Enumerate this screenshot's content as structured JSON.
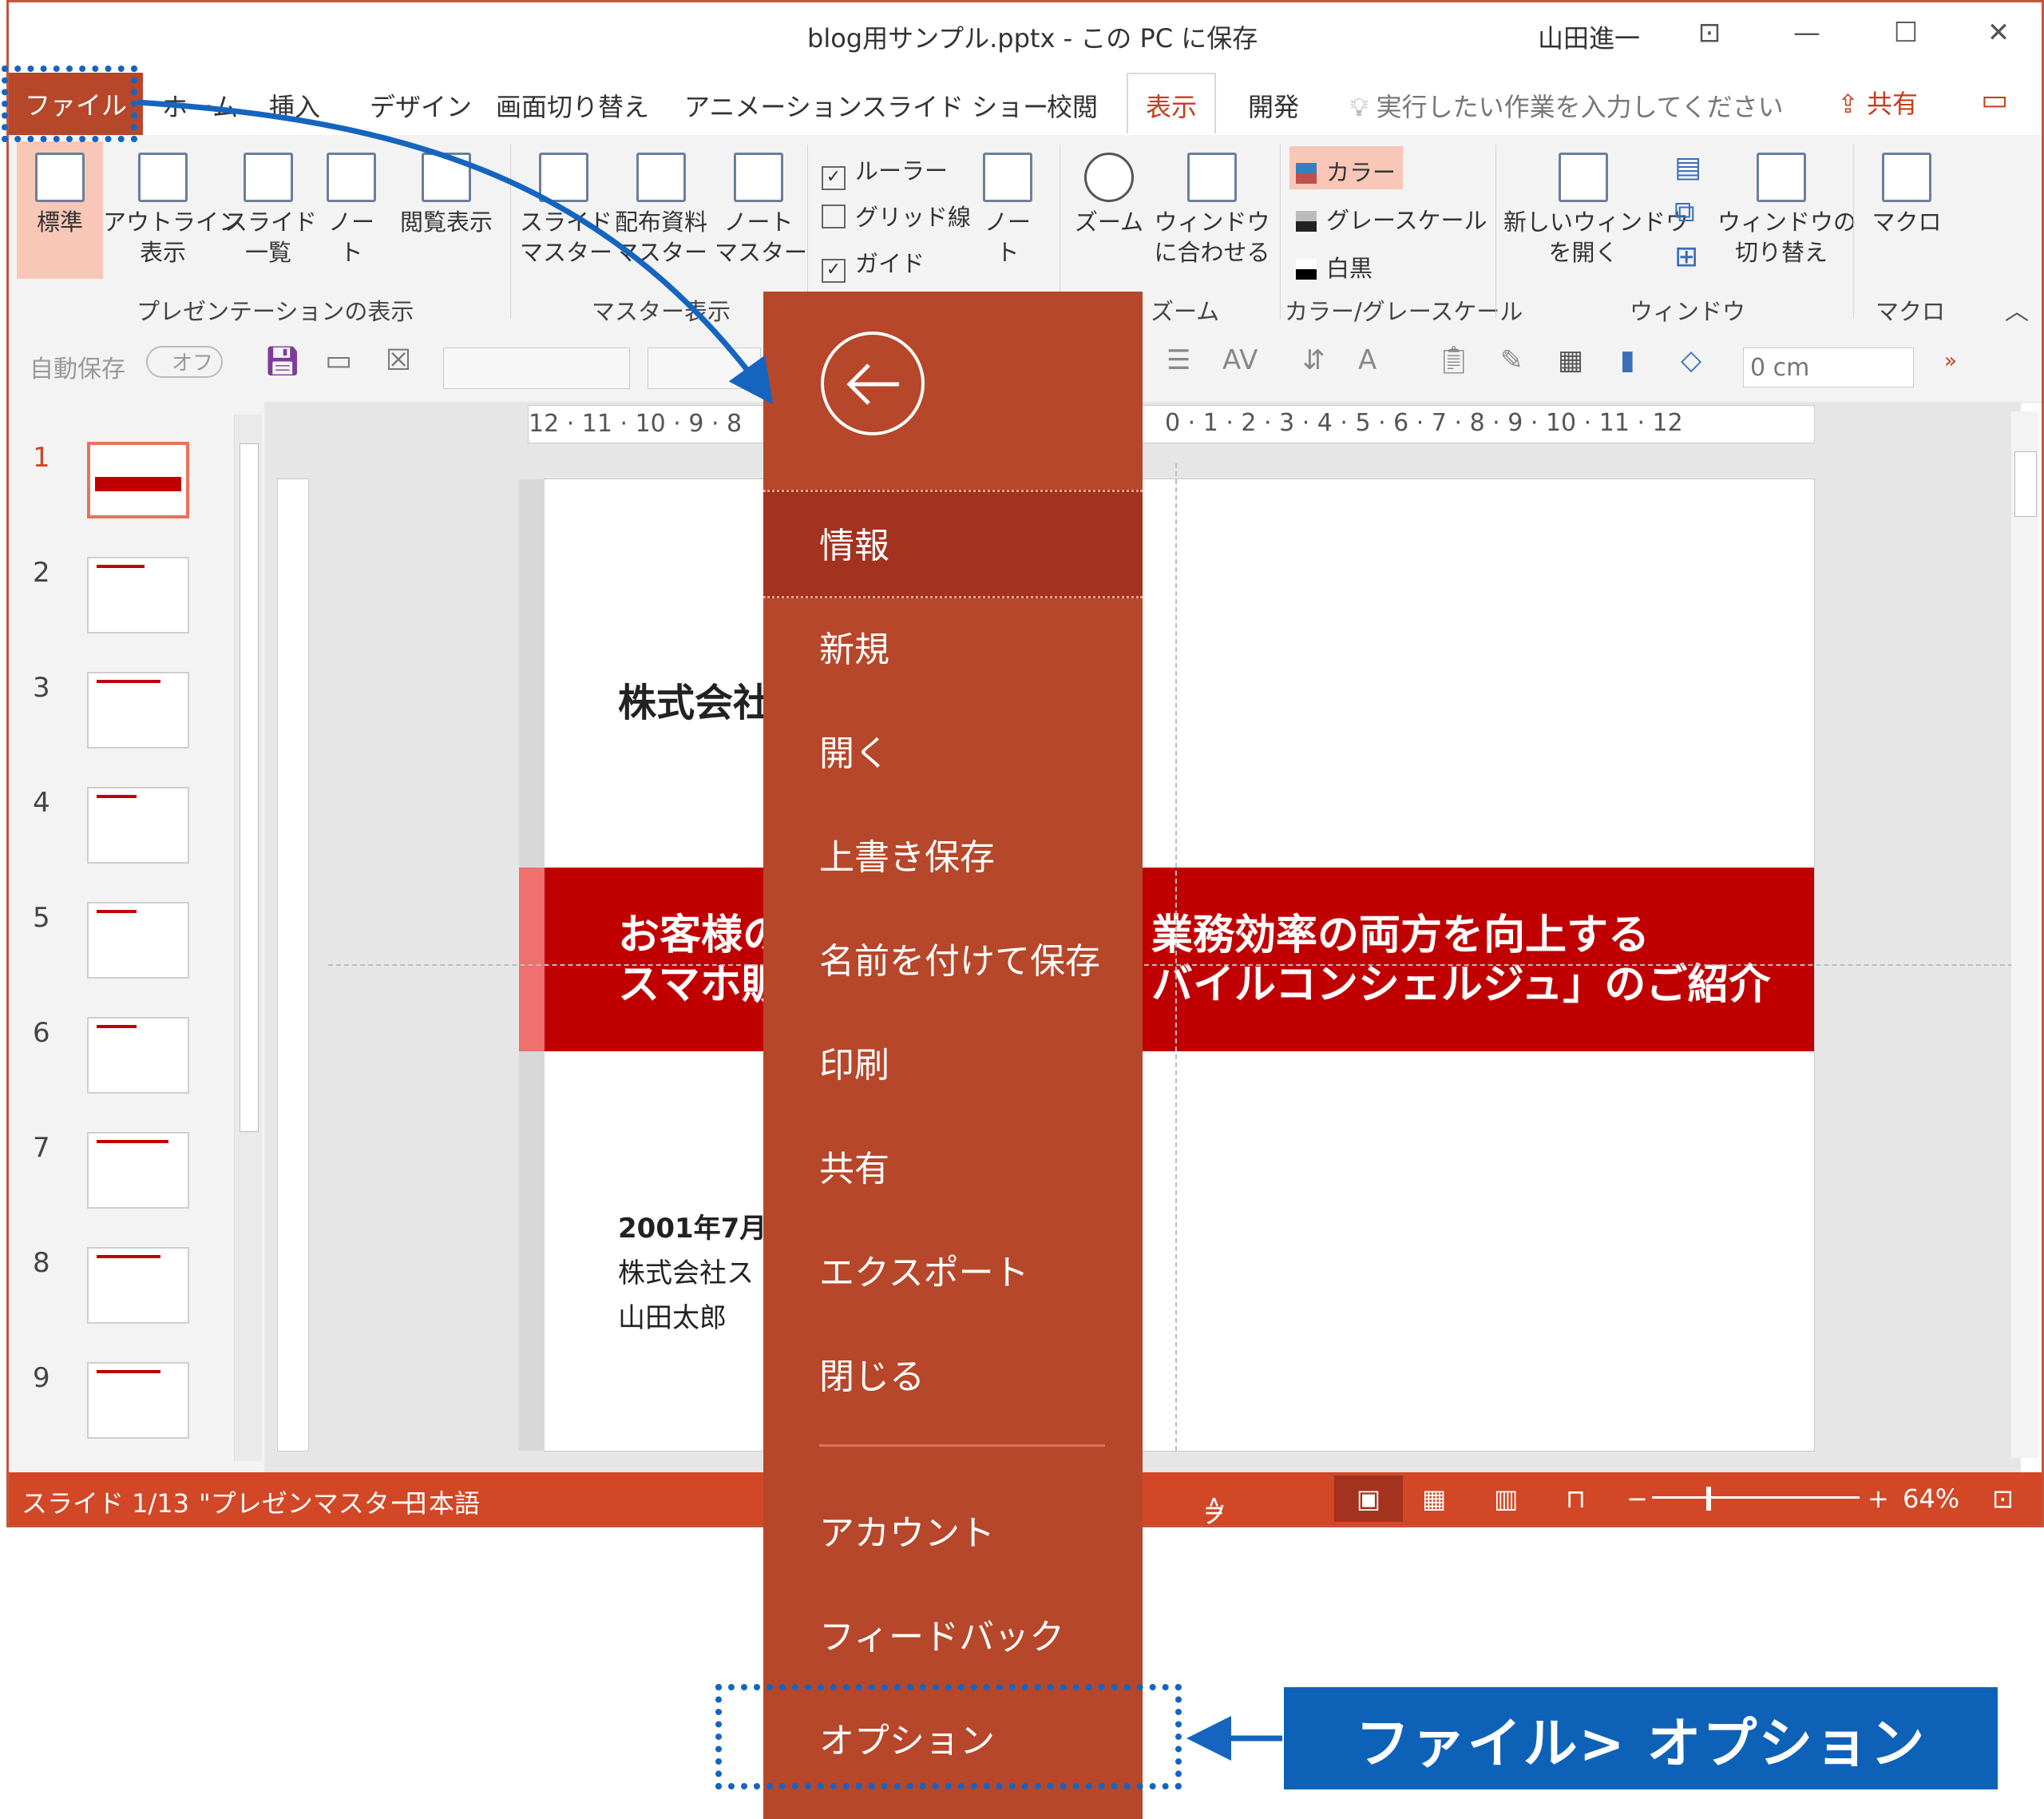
{
  "window": {
    "title": "blog用サンプル.pptx - この PC に保存",
    "user": "山田進一",
    "controls": [
      "—",
      "☐",
      "✕"
    ]
  },
  "tabs": {
    "file": "ファイル",
    "items": [
      "ホーム",
      "挿入",
      "デザイン",
      "画面切り替え",
      "アニメーション",
      "スライド ショー",
      "校閲",
      "表示",
      "開発"
    ],
    "active": "表示",
    "tell_me": "実行したい作業を入力してください",
    "share": "共有"
  },
  "ribbon": {
    "presentation_views": {
      "label": "プレゼンテーションの表示",
      "buttons": [
        "標準",
        "アウトライン\n表示",
        "スライド\n一覧",
        "ノー\nト",
        "閲覧表示"
      ]
    },
    "master_views": {
      "label": "マスター表示",
      "buttons": [
        "スライド\nマスター",
        "配布資料\nマスター",
        "ノート\nマスター"
      ]
    },
    "show": {
      "ruler": "ルーラー",
      "gridlines": "グリッド線",
      "guides": "ガイド",
      "notes": "ノー\nト"
    },
    "zoom": {
      "label": "ズーム",
      "zoom_btn": "ズーム",
      "fit_btn": "ウィンドウ\nに合わせる"
    },
    "color": {
      "label": "カラー/グレースケール",
      "items": [
        "カラー",
        "グレースケール",
        "白黒"
      ]
    },
    "window": {
      "label": "ウィンドウ",
      "new_window": "新しいウィンドウ\nを開く",
      "switch": "ウィンドウの\n切り替え"
    },
    "macro": {
      "label": "マクロ",
      "btn": "マクロ"
    }
  },
  "qat": {
    "autosave": "自動保存",
    "toggle": "オフ",
    "indent_value": "0 cm"
  },
  "rulers": {
    "horizontal_left": "12 · 11 · 10 · 9 · 8",
    "horizontal_right": "0 · 1 · 2 · 3 · 4 · 5 · 6 · 7 · 8 · 9 · 10 · 11 · 12"
  },
  "thumbnails": [
    "1",
    "2",
    "3",
    "4",
    "5",
    "6",
    "7",
    "8",
    "9"
  ],
  "slide": {
    "title_part": "株式会社",
    "subtitle_left": "お客様の\nスマホ販",
    "subtitle_right": "業務効率の両方を向上する\nバイルコンシェルジュ」のご紹介",
    "date": "2001年7月",
    "company": "株式会社ス",
    "author": "山田太郎"
  },
  "status": {
    "slide": "スライド 1/13",
    "theme": "\"プレゼンマスター\"",
    "language": "日本語",
    "notes": "ノート",
    "zoom": "64%"
  },
  "backstage": {
    "items": [
      "情報",
      "新規",
      "開く",
      "上書き保存",
      "名前を付けて保存",
      "印刷",
      "共有",
      "エクスポート",
      "閉じる"
    ],
    "bottom": [
      "アカウント",
      "フィードバック",
      "オプション"
    ],
    "active": "情報"
  },
  "annotation": {
    "callout": "ファイル> オプション",
    "color": "#0d62b8"
  }
}
